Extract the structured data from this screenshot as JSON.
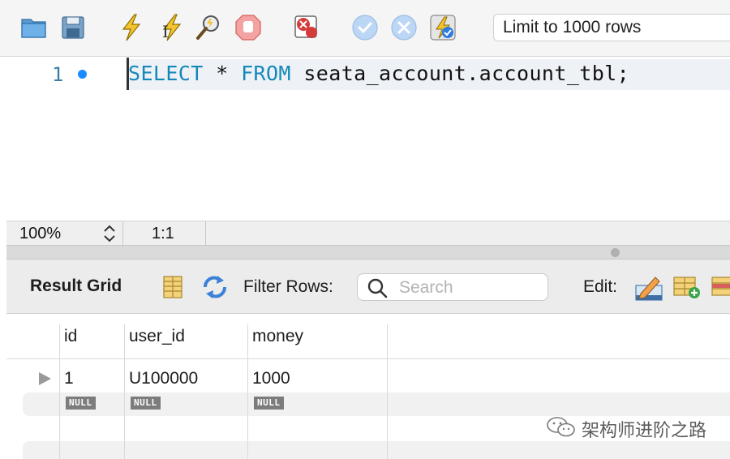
{
  "toolbar": {
    "buttons": [
      {
        "icon": "folder-icon"
      },
      {
        "icon": "save-icon"
      },
      {
        "icon": "execute-icon"
      },
      {
        "icon": "execute-statement-icon"
      },
      {
        "icon": "explain-icon"
      },
      {
        "icon": "stop-icon"
      },
      {
        "icon": "stop-on-error-icon"
      },
      {
        "icon": "commit-icon"
      },
      {
        "icon": "rollback-icon"
      },
      {
        "icon": "autocommit-icon"
      }
    ],
    "limit_value": "Limit to 1000 rows"
  },
  "editor": {
    "line_number": "1",
    "sql": {
      "kw_select": "SELECT",
      "star": " * ",
      "kw_from": "FROM",
      "rest": " seata_account.account_tbl;"
    }
  },
  "status_bar": {
    "zoom": "100%",
    "cursor": "1:1"
  },
  "result_toolbar": {
    "title": "Result Grid",
    "filter_label": "Filter Rows:",
    "search_placeholder": "Search",
    "edit_label": "Edit:"
  },
  "grid": {
    "columns": [
      "id",
      "user_id",
      "money"
    ],
    "rows": [
      [
        "1",
        "U100000",
        "1000"
      ],
      [
        "NULL",
        "NULL",
        "NULL"
      ]
    ]
  },
  "watermark": {
    "text": "架构师进阶之路"
  },
  "colors": {
    "keyword": "#1289b9",
    "gutter": "#3a7ea5",
    "breakpoint": "#1a8cff"
  }
}
